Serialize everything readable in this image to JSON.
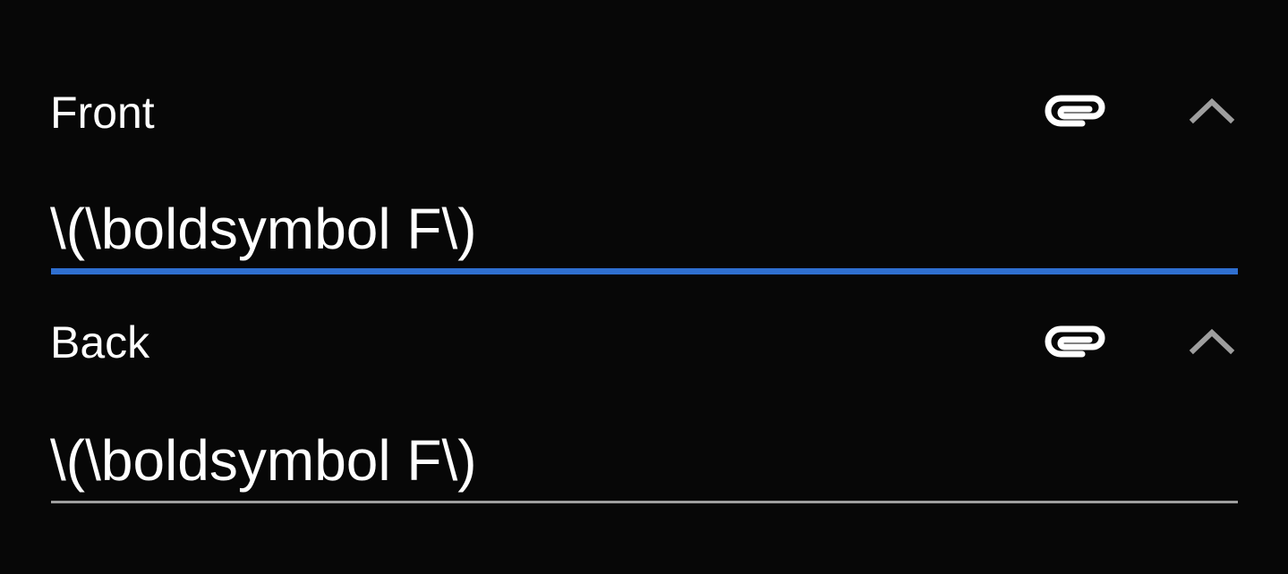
{
  "fields": [
    {
      "label": "Front",
      "value": "\\(\\boldsymbol F\\)",
      "focused": true,
      "attach_icon": "paperclip-icon",
      "collapse_icon": "chevron-up-icon"
    },
    {
      "label": "Back",
      "value": "\\(\\boldsymbol F\\)",
      "focused": false,
      "attach_icon": "paperclip-icon",
      "collapse_icon": "chevron-up-icon"
    }
  ],
  "colors": {
    "background": "#070707",
    "text": "#ffffff",
    "accent_focused_underline": "#2f6fd0",
    "idle_underline": "#9e9e9e",
    "chevron": "#9e9e9e"
  }
}
